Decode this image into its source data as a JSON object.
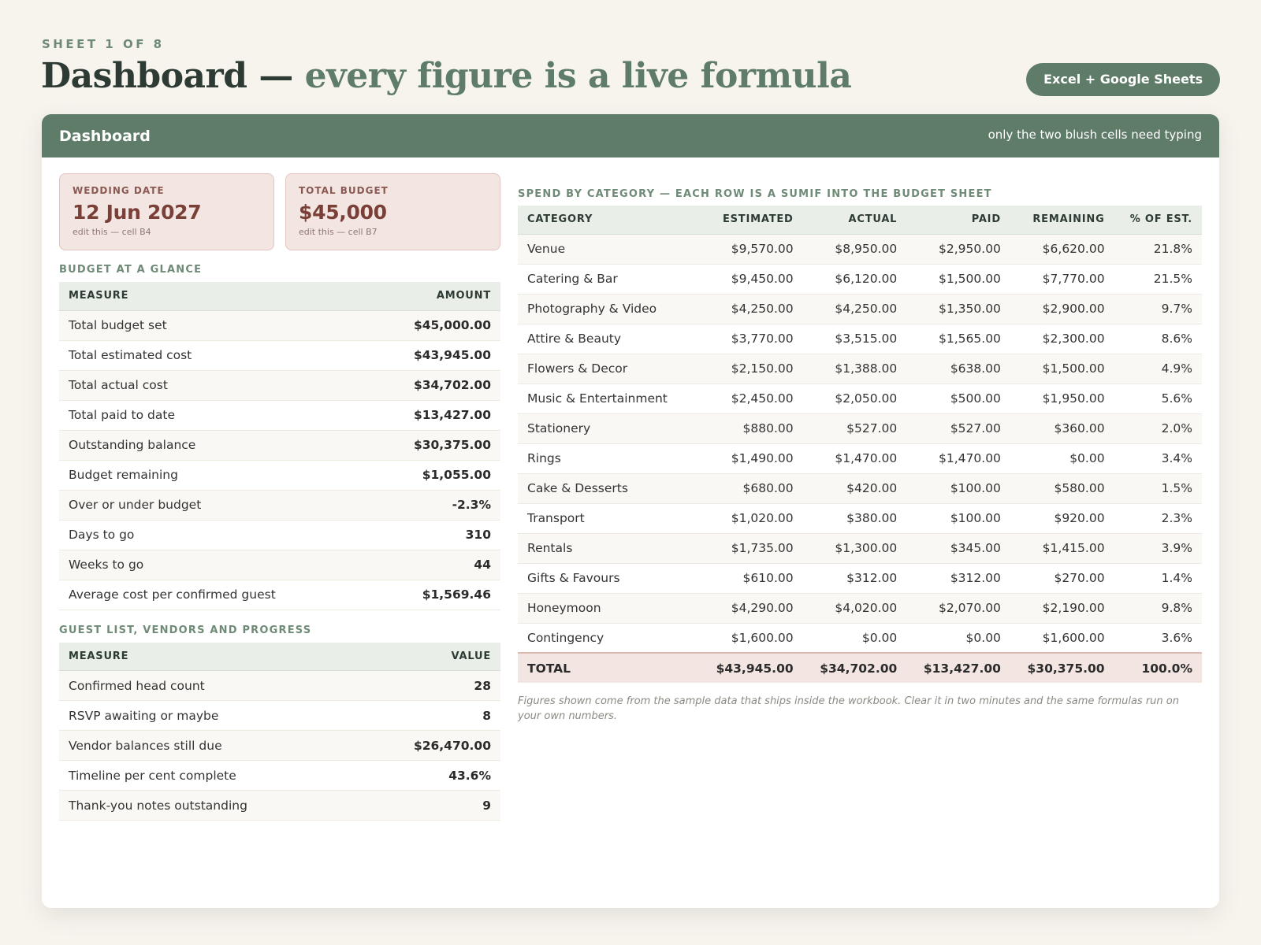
{
  "header": {
    "eyebrow": "SHEET 1 OF 8",
    "title_plain": "Dashboard — ",
    "title_accent": "every figure is a live formula",
    "badge": "Excel + Google Sheets"
  },
  "card": {
    "title": "Dashboard",
    "note": "only the two blush cells need typing"
  },
  "inputs": [
    {
      "label": "WEDDING DATE",
      "value": "12 Jun 2027",
      "hint": "edit this — cell B4"
    },
    {
      "label": "TOTAL BUDGET",
      "value": "$45,000",
      "hint": "edit this — cell B7"
    }
  ],
  "budget_glance": {
    "title": "BUDGET AT A GLANCE",
    "col_measure": "MEASURE",
    "col_value": "AMOUNT",
    "rows": [
      {
        "measure": "Total budget set",
        "value": "$45,000.00"
      },
      {
        "measure": "Total estimated cost",
        "value": "$43,945.00"
      },
      {
        "measure": "Total actual cost",
        "value": "$34,702.00"
      },
      {
        "measure": "Total paid to date",
        "value": "$13,427.00"
      },
      {
        "measure": "Outstanding balance",
        "value": "$30,375.00"
      },
      {
        "measure": "Budget remaining",
        "value": "$1,055.00"
      },
      {
        "measure": "Over or under budget",
        "value": "-2.3%"
      },
      {
        "measure": "Days to go",
        "value": "310"
      },
      {
        "measure": "Weeks to go",
        "value": "44"
      },
      {
        "measure": "Average cost per confirmed guest",
        "value": "$1,569.46"
      }
    ]
  },
  "guest_list": {
    "title": "GUEST LIST, VENDORS AND PROGRESS",
    "col_measure": "MEASURE",
    "col_value": "VALUE",
    "rows": [
      {
        "measure": "Confirmed head count",
        "value": "28"
      },
      {
        "measure": "RSVP awaiting or maybe",
        "value": "8"
      },
      {
        "measure": "Vendor balances still due",
        "value": "$26,470.00"
      },
      {
        "measure": "Timeline per cent complete",
        "value": "43.6%"
      },
      {
        "measure": "Thank-you notes outstanding",
        "value": "9"
      }
    ]
  },
  "spend": {
    "title": "SPEND BY CATEGORY — EACH ROW IS A SUMIF INTO THE BUDGET SHEET",
    "columns": [
      "CATEGORY",
      "ESTIMATED",
      "ACTUAL",
      "PAID",
      "REMAINING",
      "% OF EST."
    ],
    "rows": [
      [
        "Venue",
        "$9,570.00",
        "$8,950.00",
        "$2,950.00",
        "$6,620.00",
        "21.8%"
      ],
      [
        "Catering & Bar",
        "$9,450.00",
        "$6,120.00",
        "$1,500.00",
        "$7,770.00",
        "21.5%"
      ],
      [
        "Photography & Video",
        "$4,250.00",
        "$4,250.00",
        "$1,350.00",
        "$2,900.00",
        "9.7%"
      ],
      [
        "Attire & Beauty",
        "$3,770.00",
        "$3,515.00",
        "$1,565.00",
        "$2,300.00",
        "8.6%"
      ],
      [
        "Flowers & Decor",
        "$2,150.00",
        "$1,388.00",
        "$638.00",
        "$1,500.00",
        "4.9%"
      ],
      [
        "Music & Entertainment",
        "$2,450.00",
        "$2,050.00",
        "$500.00",
        "$1,950.00",
        "5.6%"
      ],
      [
        "Stationery",
        "$880.00",
        "$527.00",
        "$527.00",
        "$360.00",
        "2.0%"
      ],
      [
        "Rings",
        "$1,490.00",
        "$1,470.00",
        "$1,470.00",
        "$0.00",
        "3.4%"
      ],
      [
        "Cake & Desserts",
        "$680.00",
        "$420.00",
        "$100.00",
        "$580.00",
        "1.5%"
      ],
      [
        "Transport",
        "$1,020.00",
        "$380.00",
        "$100.00",
        "$920.00",
        "2.3%"
      ],
      [
        "Rentals",
        "$1,735.00",
        "$1,300.00",
        "$345.00",
        "$1,415.00",
        "3.9%"
      ],
      [
        "Gifts & Favours",
        "$610.00",
        "$312.00",
        "$312.00",
        "$270.00",
        "1.4%"
      ],
      [
        "Honeymoon",
        "$4,290.00",
        "$4,020.00",
        "$2,070.00",
        "$2,190.00",
        "9.8%"
      ],
      [
        "Contingency",
        "$1,600.00",
        "$0.00",
        "$0.00",
        "$1,600.00",
        "3.6%"
      ]
    ],
    "total": [
      "TOTAL",
      "$43,945.00",
      "$34,702.00",
      "$13,427.00",
      "$30,375.00",
      "100.0%"
    ]
  },
  "footnote": "Figures shown come from the sample data that ships inside the workbook. Clear it in two minutes and the same formulas run on your own numbers."
}
